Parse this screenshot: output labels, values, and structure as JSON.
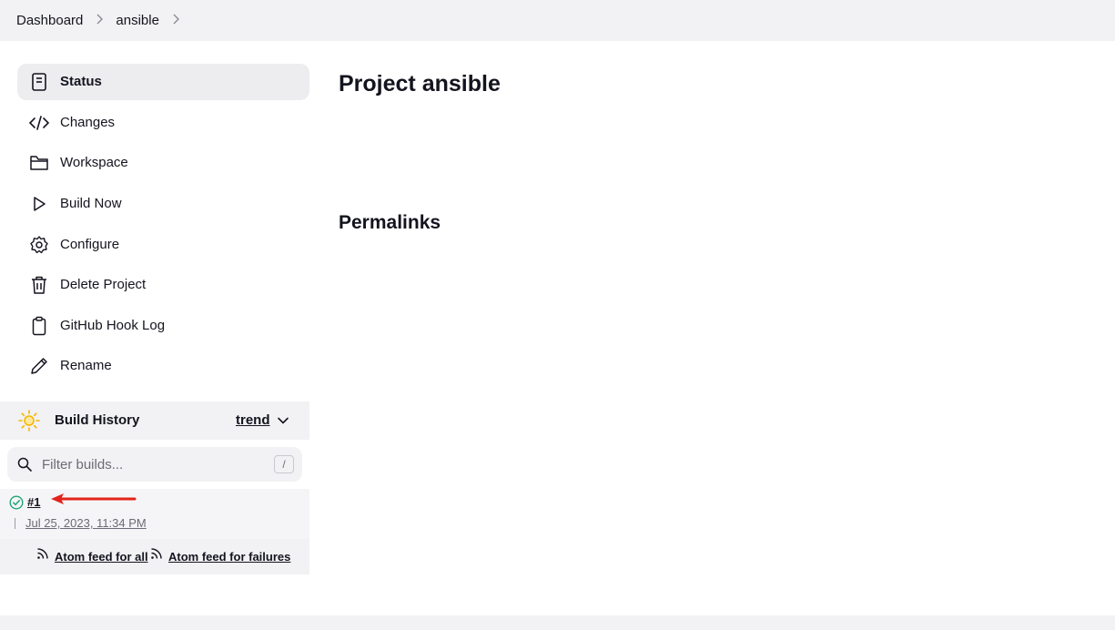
{
  "breadcrumb": {
    "items": [
      "Dashboard",
      "ansible"
    ]
  },
  "sidebar": {
    "tasks": [
      {
        "label": "Status",
        "icon": "status-document-icon",
        "active": true
      },
      {
        "label": "Changes",
        "icon": "code-icon"
      },
      {
        "label": "Workspace",
        "icon": "folder-icon"
      },
      {
        "label": "Build Now",
        "icon": "play-icon"
      },
      {
        "label": "Configure",
        "icon": "gear-icon"
      },
      {
        "label": "Delete Project",
        "icon": "trash-icon"
      },
      {
        "label": "GitHub Hook Log",
        "icon": "clipboard-icon"
      },
      {
        "label": "Rename",
        "icon": "pencil-icon"
      }
    ]
  },
  "build_history": {
    "title": "Build History",
    "trend_label": "trend",
    "filter_placeholder": "Filter builds...",
    "filter_shortcut": "/",
    "builds": [
      {
        "number": "#1",
        "date": "Jul 25, 2023, 11:34 PM",
        "status": "success"
      }
    ],
    "feed_all": "Atom feed for all",
    "feed_failures": "Atom feed for failures"
  },
  "main": {
    "title": "Project ansible",
    "permalinks_heading": "Permalinks"
  },
  "colors": {
    "success": "#1ea672",
    "annotation_arrow": "#e3231b",
    "weather_sun": "#f5b400"
  }
}
